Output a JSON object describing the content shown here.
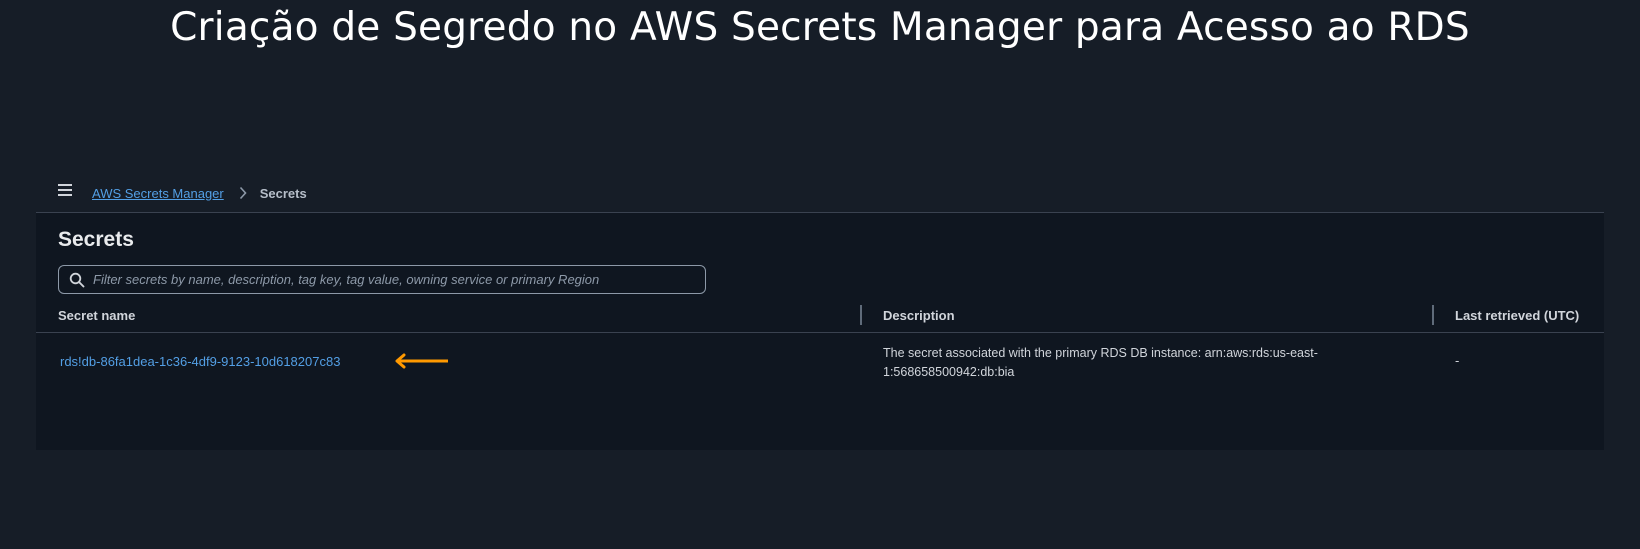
{
  "slide": {
    "title": "Criação de Segredo no AWS Secrets Manager para Acesso ao RDS"
  },
  "breadcrumb": {
    "service": "AWS Secrets Manager",
    "current": "Secrets"
  },
  "page": {
    "heading": "Secrets"
  },
  "search": {
    "placeholder": "Filter secrets by name, description, tag key, tag value, owning service or primary Region"
  },
  "table": {
    "columns": [
      "Secret name",
      "Description",
      "Last retrieved (UTC)"
    ],
    "rows": [
      {
        "name": "rds!db-86fa1dea-1c36-4df9-9123-10d618207c83",
        "description": "The secret associated with the primary RDS DB instance: arn:aws:rds:us-east-1:568658500942:db:bia",
        "last_retrieved": "-"
      }
    ]
  },
  "colors": {
    "background": "#161d27",
    "link": "#539fe5",
    "annotation_arrow": "#ff9900"
  },
  "icons": {
    "menu": "hamburger-menu-icon",
    "breadcrumb_separator": "chevron-right-icon",
    "search": "search-icon",
    "annotation": "arrow-left-icon"
  }
}
